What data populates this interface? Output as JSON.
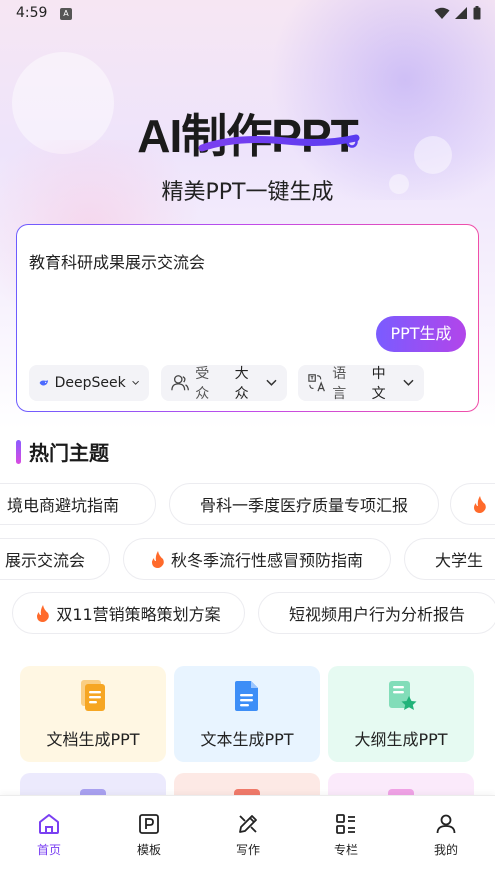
{
  "status_bar": {
    "time": "4:59",
    "notification_letter": "A"
  },
  "hero": {
    "title": "AI制作PPT",
    "subtitle": "精美PPT一键生成"
  },
  "input_card": {
    "value": "教育科研成果展示交流会",
    "generate_label": "PPT生成",
    "model": {
      "value": "DeepSeek"
    },
    "audience": {
      "label": "受众",
      "value": "大众"
    },
    "language": {
      "label": "语言",
      "value": "中文"
    }
  },
  "hot_topics": {
    "title": "热门主题",
    "rows": [
      [
        {
          "text": "境电商避坑指南",
          "hot": false
        },
        {
          "text": "骨科一季度医疗质量专项汇报",
          "hot": false
        },
        {
          "text": "",
          "hot": true
        }
      ],
      [
        {
          "text": "展示交流会",
          "hot": false
        },
        {
          "text": "秋冬季流行性感冒预防指南",
          "hot": true
        },
        {
          "text": "大学生",
          "hot": false
        }
      ],
      [
        {
          "text": "双11营销策略策划方案",
          "hot": true
        },
        {
          "text": "短视频用户行为分析报告",
          "hot": false
        }
      ]
    ]
  },
  "features": [
    {
      "label": "文档生成PPT",
      "icon": "document-icon",
      "color": "#f6a623"
    },
    {
      "label": "文本生成PPT",
      "icon": "text-file-icon",
      "color": "#3d8ef7"
    },
    {
      "label": "大纲生成PPT",
      "icon": "outline-icon",
      "color": "#2fc58a"
    }
  ],
  "bottom_nav": [
    {
      "label": "首页",
      "icon": "home-icon",
      "active": true
    },
    {
      "label": "模板",
      "icon": "template-icon",
      "active": false
    },
    {
      "label": "写作",
      "icon": "pen-icon",
      "active": false
    },
    {
      "label": "专栏",
      "icon": "column-icon",
      "active": false
    },
    {
      "label": "我的",
      "icon": "profile-icon",
      "active": false
    }
  ],
  "colors": {
    "accent": "#7a3ff2",
    "hot": "#ff6a2b"
  }
}
